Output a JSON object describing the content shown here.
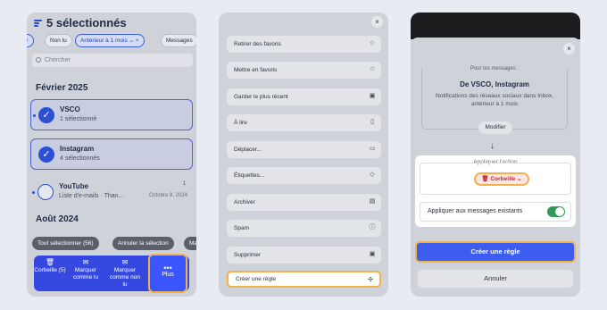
{
  "panel1": {
    "title": "5 sélectionnés",
    "chips": [
      "×",
      "Non lu",
      "Antérieur à 1 mois ⌄ ×",
      "Messages"
    ],
    "search_placeholder": "Chercher",
    "month1": "Février 2025",
    "senders": [
      {
        "name": "VSCO",
        "sub": "1 sélectionné",
        "selected": true
      },
      {
        "name": "Instagram",
        "sub": "4 sélectionnés",
        "selected": true
      },
      {
        "name": "YouTube",
        "sub": "Liste d'e-mails · Than...",
        "date": "Octobre 8, 2024",
        "count": "1",
        "selected": false
      }
    ],
    "month2": "Août 2024",
    "pills": [
      "Tout sélectionner (56)",
      "Annuler la sélection",
      "Mar"
    ],
    "bottom": {
      "trash": "Corbeille (5)",
      "mark_read": "Marquer comme lu",
      "mark_unread": "Marquer comme non lu",
      "more": "Plus"
    }
  },
  "panel2": {
    "close": "×",
    "actions": [
      {
        "label": "Retirer des favoris",
        "icon": "☆"
      },
      {
        "label": "Mettre en favoris",
        "icon": "☆"
      },
      {
        "label": "Garder le plus récent",
        "icon": "▣"
      },
      {
        "label": "À lire",
        "icon": "▯"
      },
      {
        "label": "Déplacer...",
        "icon": "▭"
      },
      {
        "label": "Étiquettes...",
        "icon": "◇"
      },
      {
        "label": "Archiver",
        "icon": "▤"
      },
      {
        "label": "Spam",
        "icon": "ⓘ"
      },
      {
        "label": "Supprimer",
        "icon": "▣"
      },
      {
        "label": "Créer une règle",
        "icon": "✣"
      }
    ]
  },
  "panel3": {
    "close": "×",
    "for_messages": "Pour les messages :",
    "from": "De VSCO, Instagram",
    "desc": "Notifications des réseaux sociaux dans Inbox, antérieur à 1 mois",
    "modify": "Modifier",
    "arrow": "↓",
    "apply_action": "Appliquer l'action",
    "trash_action": "Corbeille ⌄",
    "apply_existing": "Appliquer aux messages existants",
    "create_rule": "Créer une règle",
    "cancel": "Annuler"
  }
}
